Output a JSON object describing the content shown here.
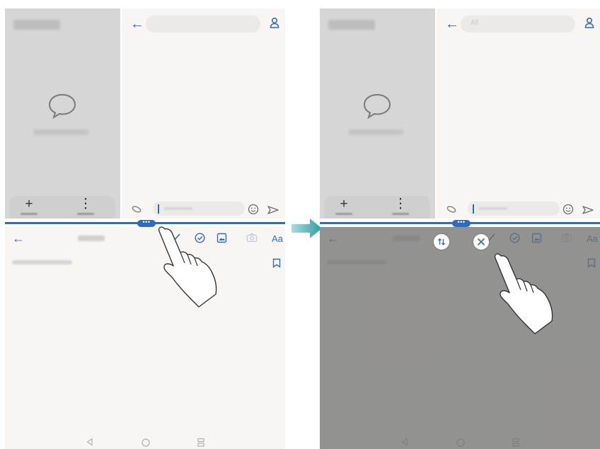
{
  "colors": {
    "accent": "#2e6cc0",
    "arrow": "#3aa6a9",
    "panel_gray": "#d6d6d6",
    "content_bg": "#f8f5f2",
    "overlay": "#6e6e6e"
  },
  "left_screen": {
    "bottom_toolbar": {
      "font_button_label": "Aa"
    },
    "icons": [
      "back-arrow-icon",
      "person-icon",
      "paperclip-icon",
      "emoji-icon",
      "send-icon",
      "check-icon",
      "check-circle-icon",
      "image-icon",
      "camera-icon",
      "bookmark-icon"
    ],
    "divider_handle": "•••"
  },
  "right_screen": {
    "bottom_toolbar": {
      "font_button_label": "Aa"
    },
    "search_placeholder": "All",
    "buttons": [
      "swap-windows-button",
      "close-split-screen-button"
    ],
    "divider_handle": "•••"
  },
  "navigation": [
    "back-nav-icon",
    "home-nav-icon",
    "recents-nav-icon"
  ]
}
